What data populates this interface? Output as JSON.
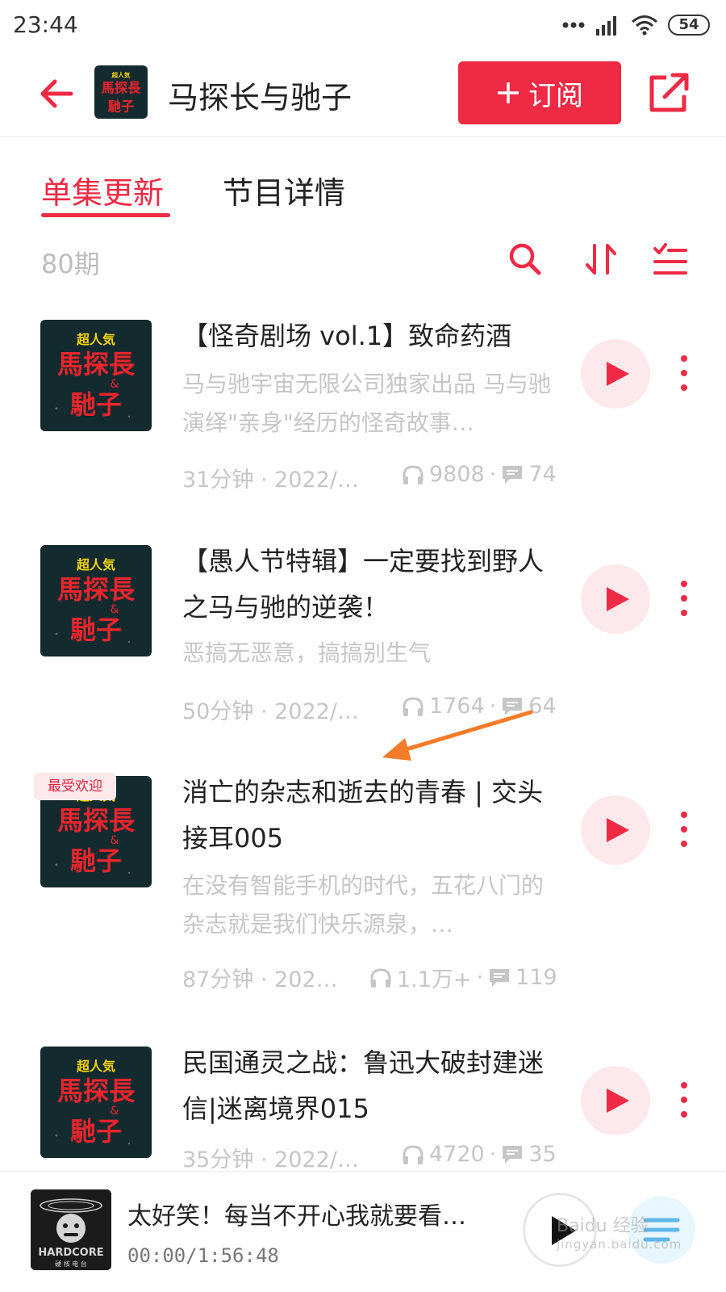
{
  "status_bar": {
    "time": "23:44",
    "battery": "54"
  },
  "header": {
    "title": "马探长与驰子",
    "subscribe_label": "订阅"
  },
  "tabs": [
    {
      "label": "单集更新"
    },
    {
      "label": "节目详情"
    }
  ],
  "toolbar": {
    "episode_count": "80期"
  },
  "cover_art": {
    "top_text": "超人気",
    "line1": "馬探長",
    "amp": "&",
    "line2": "馳子"
  },
  "episodes": [
    {
      "title": "【怪奇剧场 vol.1】致命药酒",
      "description": "马与驰宇宙无限公司独家出品 马与驰演绎\"亲身\"经历的怪奇故事…",
      "duration_date": "31分钟 · 2022/0...",
      "plays": "9808",
      "comments": "74"
    },
    {
      "title": "【愚人节特辑】一定要找到野人之马与驰的逆袭！",
      "description": "恶搞无恶意，搞搞别生气",
      "duration_date": "50分钟 · 2022/0...",
      "plays": "1764",
      "comments": "64"
    },
    {
      "badge": "最受欢迎",
      "title": "消亡的杂志和逝去的青春 | 交头接耳005",
      "description": "在没有智能手机的时代，五花八门的杂志就是我们快乐源泉，…",
      "duration_date": "87分钟 · 2022...",
      "plays": "1.1万+",
      "comments": "119"
    },
    {
      "title": "民国通灵之战：鲁迅大破封建迷信|迷离境界015",
      "duration_date": "35分钟 · 2022/0...",
      "plays": "4720",
      "comments": "35"
    }
  ],
  "player": {
    "title": "太好笑！每当不开心我就要看…",
    "time": "00:00/1:56:48",
    "cover_text": "HARDCORE",
    "cover_subtext": "硬 核 电 台"
  },
  "watermark": {
    "main": "Baidu 经验",
    "sub": "jingyan.baidu.com"
  },
  "colors": {
    "accent": "#ee2a45",
    "accent_light": "#fde8ec",
    "muted": "#c6c6c6"
  }
}
